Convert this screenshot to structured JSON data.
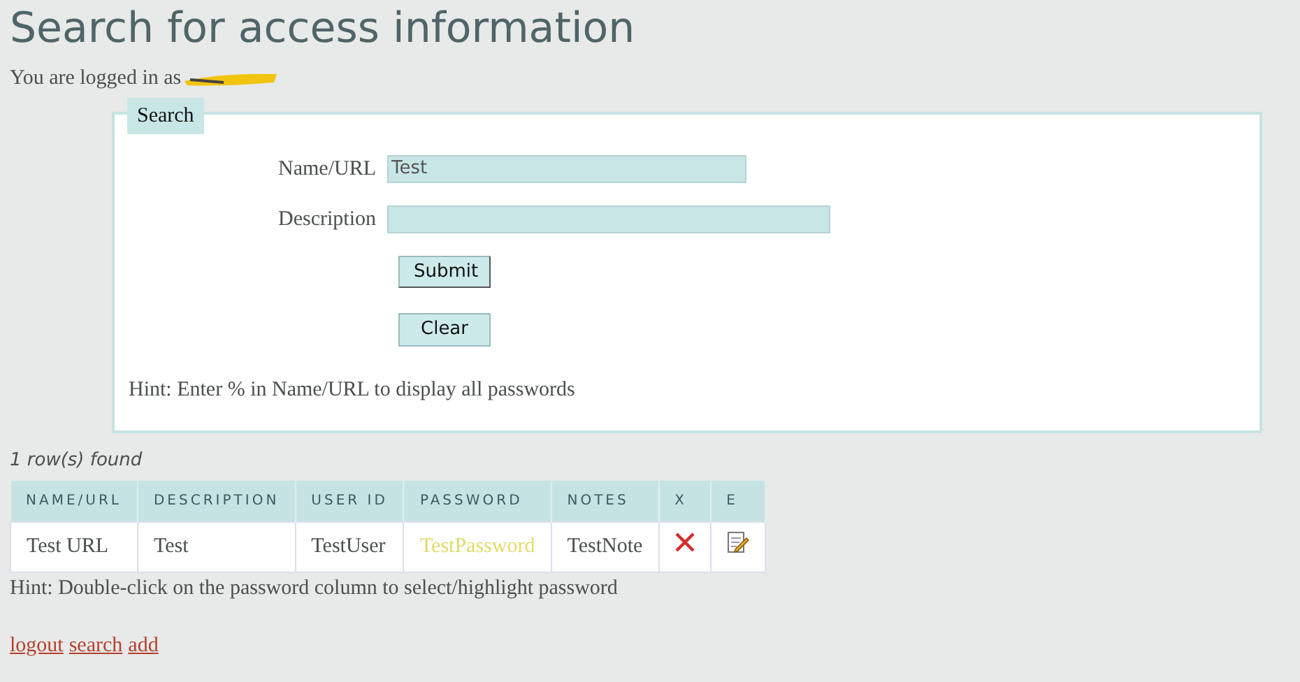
{
  "title": "Search for access information",
  "login": {
    "text": "You are logged in as",
    "redacted": true
  },
  "search": {
    "legend": "Search",
    "fields": [
      {
        "label": "Name/URL",
        "value": "Test"
      },
      {
        "label": "Description"
      }
    ],
    "buttons": [
      "Submit",
      "Clear"
    ],
    "hint": "Hint: Enter % in Name/URL to display all passwords"
  },
  "results": {
    "count": "1 row(s) found",
    "columns": [
      "NAME/URL",
      "DESCRIPTION",
      "USER ID",
      "PASSWORD",
      "NOTES",
      "X",
      "E"
    ],
    "rows": [
      {
        "cells": [
          {
            "kind": "text",
            "text": "Test URL"
          },
          {
            "kind": "text",
            "text": "Test"
          },
          {
            "kind": "text",
            "text": "TestUser"
          },
          {
            "kind": "password",
            "text": "TestPassword"
          },
          {
            "kind": "text",
            "text": "TestNote"
          },
          {
            "kind": "delete"
          },
          {
            "kind": "edit"
          }
        ]
      }
    ],
    "hint": "Hint: Double-click on the password column to select/highlight password"
  },
  "links": [
    "logout",
    "search",
    "add"
  ]
}
